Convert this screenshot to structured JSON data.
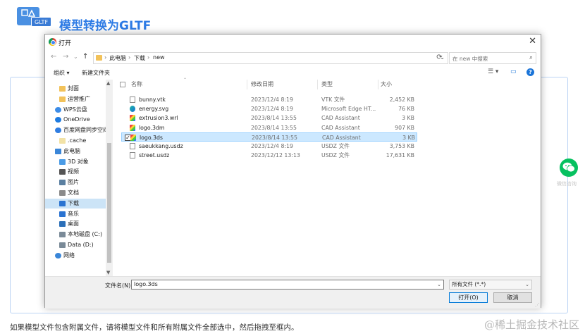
{
  "app": {
    "logo_text": "GLTF",
    "title": "模型转换为GLTF",
    "hint": "如果模型文件包含附属文件，请将模型文件和所有附属文件全部选中，然后拖拽至框内。",
    "watermark": "@稀土掘金技术社区",
    "wechat_label": "微信咨询"
  },
  "dialog": {
    "title": "打开",
    "close": "✕",
    "nav": {
      "back": "←",
      "forward": "→",
      "dropdown": "⌄",
      "up": "↑"
    },
    "breadcrumb": [
      "此电脑",
      "下载",
      "new"
    ],
    "breadcrumb_sep": "›",
    "address_dropdown": "⌄",
    "refresh": "⟳",
    "search_placeholder": "在 new 中搜索",
    "search_icon": "⌕",
    "toolbar": {
      "organize": "组织 ▾",
      "new_folder": "新建文件夹",
      "view": "☰ ▾",
      "preview": "▭",
      "help": "?"
    },
    "sidebar": [
      {
        "label": "封面",
        "icon": "folder",
        "color": "#f2c25a",
        "indent": 1
      },
      {
        "label": "运营推广",
        "icon": "folder",
        "color": "#f2c25a",
        "indent": 1
      },
      {
        "label": "WPS云盘",
        "icon": "cloud",
        "color": "#3c8ce7",
        "indent": 0
      },
      {
        "label": "OneDrive",
        "icon": "cloud",
        "color": "#1e7be0",
        "indent": 0
      },
      {
        "label": "百度网盘同步空间",
        "icon": "baidu",
        "color": "#2f7de1",
        "indent": 0
      },
      {
        "label": ".cache",
        "icon": "folder",
        "color": "#f2e2a6",
        "indent": 1
      },
      {
        "label": "此电脑",
        "icon": "computer",
        "color": "#3a86d8",
        "indent": 0
      },
      {
        "label": "3D 对象",
        "icon": "3d",
        "color": "#4a9be5",
        "indent": 1
      },
      {
        "label": "视频",
        "icon": "video",
        "color": "#555555",
        "indent": 1
      },
      {
        "label": "图片",
        "icon": "pictures",
        "color": "#5a7fa0",
        "indent": 1
      },
      {
        "label": "文档",
        "icon": "documents",
        "color": "#8a8a8a",
        "indent": 1
      },
      {
        "label": "下载",
        "icon": "download",
        "color": "#2a73d1",
        "indent": 1,
        "selected": true
      },
      {
        "label": "音乐",
        "icon": "music",
        "color": "#2a73d1",
        "indent": 1
      },
      {
        "label": "桌面",
        "icon": "desktop",
        "color": "#2b6fb8",
        "indent": 1
      },
      {
        "label": "本地磁盘 (C:)",
        "icon": "disk",
        "color": "#7a8a98",
        "indent": 1
      },
      {
        "label": "Data (D:)",
        "icon": "disk",
        "color": "#7a8a98",
        "indent": 1
      },
      {
        "label": "网络",
        "icon": "network",
        "color": "#3a86d8",
        "indent": 0
      }
    ],
    "columns": {
      "name": "名称",
      "date": "修改日期",
      "type": "类型",
      "size": "大小"
    },
    "files": [
      {
        "name": "bunny.vtk",
        "date": "2023/12/4 8:19",
        "type": "VTK 文件",
        "size": "2,452 KB",
        "icon": "doc"
      },
      {
        "name": "energy.svg",
        "date": "2023/12/4 8:19",
        "type": "Microsoft Edge HT...",
        "size": "76 KB",
        "icon": "edge"
      },
      {
        "name": "extrusion3.wrl",
        "date": "2023/8/14 13:55",
        "type": "CAD Assistant",
        "size": "3 KB",
        "icon": "cad"
      },
      {
        "name": "logo.3dm",
        "date": "2023/8/14 13:55",
        "type": "CAD Assistant",
        "size": "907 KB",
        "icon": "cad"
      },
      {
        "name": "logo.3ds",
        "date": "2023/8/14 13:55",
        "type": "CAD Assistant",
        "size": "3 KB",
        "icon": "cad",
        "selected": true
      },
      {
        "name": "saeukkang.usdz",
        "date": "2023/12/4 8:19",
        "type": "USDZ 文件",
        "size": "3,753 KB",
        "icon": "doc"
      },
      {
        "name": "street.usdz",
        "date": "2023/12/12 13:13",
        "type": "USDZ 文件",
        "size": "17,631 KB",
        "icon": "doc"
      }
    ],
    "filename_label": "文件名(N):",
    "filename_value": "logo.3ds",
    "filetype_value": "所有文件 (*.*)",
    "open_button": "打开(O)",
    "cancel_button": "取消"
  }
}
